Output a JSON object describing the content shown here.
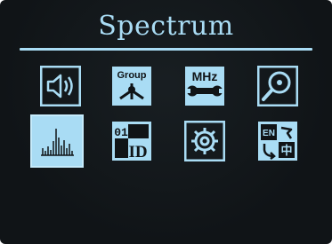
{
  "screen": {
    "title": "Spectrum",
    "accent_color": "#a9dcf4",
    "background_color": "#101417"
  },
  "menu": {
    "selected_index": 4,
    "items": [
      {
        "icon": "speaker-volume-icon"
      },
      {
        "icon": "group-network-icon",
        "label": "Group"
      },
      {
        "icon": "mhz-wrench-icon",
        "label": "MHz"
      },
      {
        "icon": "search-scan-icon"
      },
      {
        "icon": "spectrum-bars-icon",
        "selected": true
      },
      {
        "icon": "id-number-icon",
        "label": "01",
        "label2": "ID"
      },
      {
        "icon": "settings-gear-icon"
      },
      {
        "icon": "language-icon",
        "label": "EN",
        "label2": "中"
      }
    ]
  }
}
